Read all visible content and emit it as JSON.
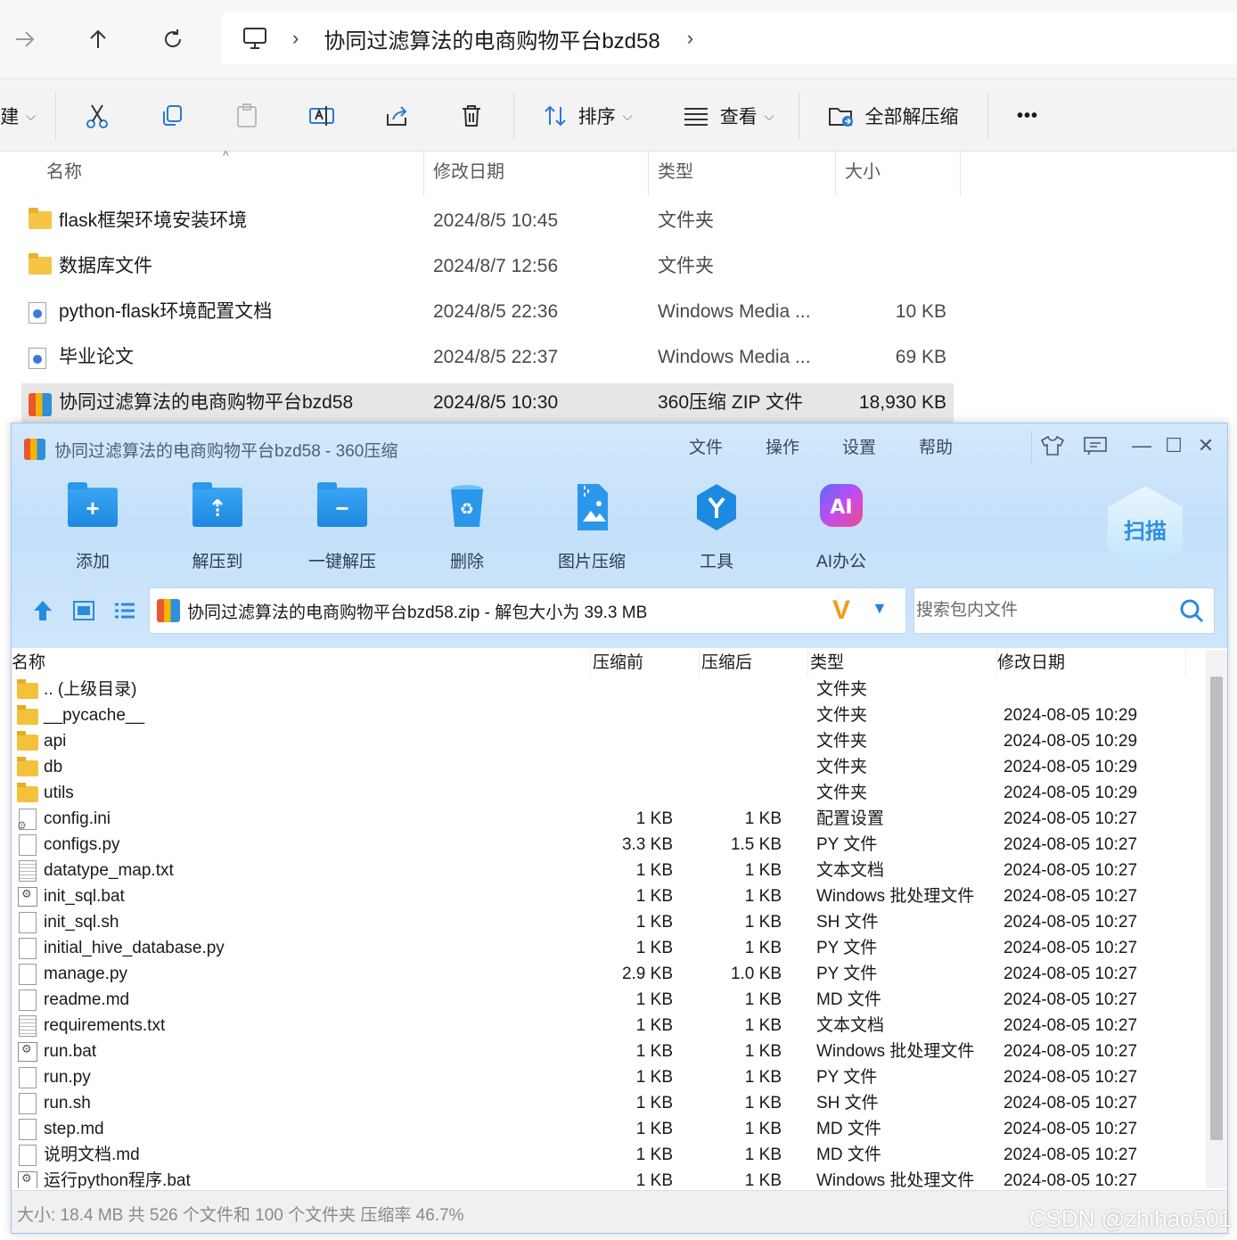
{
  "explorer": {
    "breadcrumb": "协同过滤算法的电商购物平台bzd58",
    "toolbar": {
      "new_partial": "建",
      "sort_label": "排序",
      "view_label": "查看",
      "extract_all_label": "全部解压缩",
      "more_label": "•••"
    },
    "columns": {
      "name": "名称",
      "date": "修改日期",
      "type": "类型",
      "size": "大小"
    },
    "files": [
      {
        "name": "flask框架环境安装环境",
        "date": "2024/8/5 10:45",
        "type": "文件夹",
        "size": "",
        "icon": "folder-icon"
      },
      {
        "name": "数据库文件",
        "date": "2024/8/7 12:56",
        "type": "文件夹",
        "size": "",
        "icon": "folder-icon"
      },
      {
        "name": "python-flask环境配置文档",
        "date": "2024/8/5 22:36",
        "type": "Windows Media ...",
        "size": "10 KB",
        "icon": "media-file-icon"
      },
      {
        "name": "毕业论文",
        "date": "2024/8/5 22:37",
        "type": "Windows Media ...",
        "size": "69 KB",
        "icon": "media-file-icon"
      },
      {
        "name": "协同过滤算法的电商购物平台bzd58",
        "date": "2024/8/5 10:30",
        "type": "360压缩 ZIP 文件",
        "size": "18,930 KB",
        "icon": "zip-icon",
        "selected": true
      }
    ]
  },
  "zip": {
    "title": "协同过滤算法的电商购物平台bzd58 - 360压缩",
    "menu": [
      "文件",
      "操作",
      "设置",
      "帮助"
    ],
    "tools": [
      {
        "label": "添加",
        "icon": "add-folder-icon"
      },
      {
        "label": "解压到",
        "icon": "extract-to-icon"
      },
      {
        "label": "一键解压",
        "icon": "one-click-extract-icon"
      },
      {
        "label": "删除",
        "icon": "delete-bin-icon"
      },
      {
        "label": "图片压缩",
        "icon": "image-compress-icon"
      },
      {
        "label": "工具",
        "icon": "tools-icon"
      },
      {
        "label": "AI办公",
        "icon": "ai-office-icon"
      }
    ],
    "scan_label": "扫描",
    "path_text": "协同过滤算法的电商购物平台bzd58.zip - 解包大小为 39.3 MB",
    "path_badge": "V",
    "search_placeholder": "搜索包内文件",
    "columns": {
      "name": "名称",
      "before": "压缩前",
      "after": "压缩后",
      "type": "类型",
      "date": "修改日期"
    },
    "rows": [
      {
        "name": ".. (上级目录)",
        "before": "",
        "after": "",
        "type": "文件夹",
        "date": "",
        "icon": "folder"
      },
      {
        "name": "__pycache__",
        "before": "",
        "after": "",
        "type": "文件夹",
        "date": "2024-08-05 10:29",
        "icon": "folder"
      },
      {
        "name": "api",
        "before": "",
        "after": "",
        "type": "文件夹",
        "date": "2024-08-05 10:29",
        "icon": "folder"
      },
      {
        "name": "db",
        "before": "",
        "after": "",
        "type": "文件夹",
        "date": "2024-08-05 10:29",
        "icon": "folder"
      },
      {
        "name": "utils",
        "before": "",
        "after": "",
        "type": "文件夹",
        "date": "2024-08-05 10:29",
        "icon": "folder"
      },
      {
        "name": "config.ini",
        "before": "1 KB",
        "after": "1 KB",
        "type": "配置设置",
        "date": "2024-08-05 10:27",
        "icon": "ini"
      },
      {
        "name": "configs.py",
        "before": "3.3 KB",
        "after": "1.5 KB",
        "type": "PY 文件",
        "date": "2024-08-05 10:27",
        "icon": "file"
      },
      {
        "name": "datatype_map.txt",
        "before": "1 KB",
        "after": "1 KB",
        "type": "文本文档",
        "date": "2024-08-05 10:27",
        "icon": "txt"
      },
      {
        "name": "init_sql.bat",
        "before": "1 KB",
        "after": "1 KB",
        "type": "Windows 批处理文件",
        "date": "2024-08-05 10:27",
        "icon": "bat"
      },
      {
        "name": "init_sql.sh",
        "before": "1 KB",
        "after": "1 KB",
        "type": "SH 文件",
        "date": "2024-08-05 10:27",
        "icon": "file"
      },
      {
        "name": "initial_hive_database.py",
        "before": "1 KB",
        "after": "1 KB",
        "type": "PY 文件",
        "date": "2024-08-05 10:27",
        "icon": "file"
      },
      {
        "name": "manage.py",
        "before": "2.9 KB",
        "after": "1.0 KB",
        "type": "PY 文件",
        "date": "2024-08-05 10:27",
        "icon": "file"
      },
      {
        "name": "readme.md",
        "before": "1 KB",
        "after": "1 KB",
        "type": "MD 文件",
        "date": "2024-08-05 10:27",
        "icon": "file"
      },
      {
        "name": "requirements.txt",
        "before": "1 KB",
        "after": "1 KB",
        "type": "文本文档",
        "date": "2024-08-05 10:27",
        "icon": "txt"
      },
      {
        "name": "run.bat",
        "before": "1 KB",
        "after": "1 KB",
        "type": "Windows 批处理文件",
        "date": "2024-08-05 10:27",
        "icon": "bat"
      },
      {
        "name": "run.py",
        "before": "1 KB",
        "after": "1 KB",
        "type": "PY 文件",
        "date": "2024-08-05 10:27",
        "icon": "file"
      },
      {
        "name": "run.sh",
        "before": "1 KB",
        "after": "1 KB",
        "type": "SH 文件",
        "date": "2024-08-05 10:27",
        "icon": "file"
      },
      {
        "name": "step.md",
        "before": "1 KB",
        "after": "1 KB",
        "type": "MD 文件",
        "date": "2024-08-05 10:27",
        "icon": "file"
      },
      {
        "name": "说明文档.md",
        "before": "1 KB",
        "after": "1 KB",
        "type": "MD 文件",
        "date": "2024-08-05 10:27",
        "icon": "file"
      },
      {
        "name": "运行python程序.bat",
        "before": "1 KB",
        "after": "1 KB",
        "type": "Windows 批处理文件",
        "date": "2024-08-05 10:27",
        "icon": "bat"
      }
    ],
    "status": "大小: 18.4 MB 共 526 个文件和 100 个文件夹 压缩率 46.7%"
  },
  "watermark": "CSDN @zhihao501"
}
